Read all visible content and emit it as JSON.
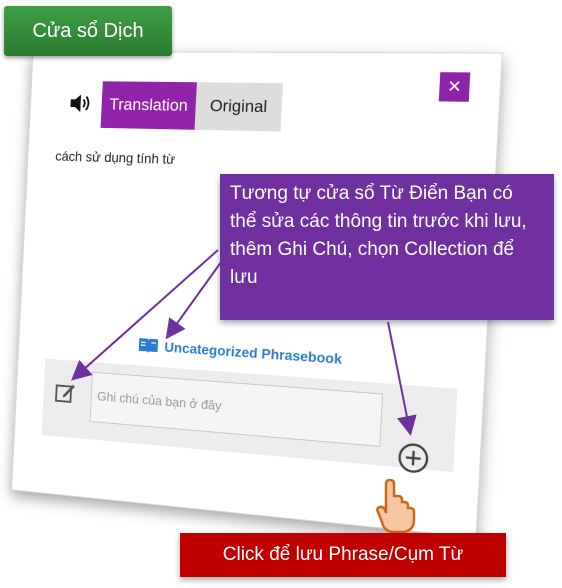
{
  "title_tag": "Cửa sổ Dịch",
  "tabs": {
    "translation": "Translation",
    "original": "Original"
  },
  "close_label": "✕",
  "source_text": "cách sử dụng tính từ",
  "collection_label": "Uncategorized Phrasebook",
  "note_placeholder": "Ghi chú của bạn ở đây",
  "callout_text": "Tương tự cửa sổ Từ Điển Bạn có thể sửa các thông tin trước khi lưu, thêm Ghi Chú, chọn Collection để lưu",
  "click_note": "Click để lưu Phrase/Cụm Từ",
  "colors": {
    "accent": "#8e24aa",
    "callout": "#7030a0",
    "tag": "#3a963e",
    "note": "#c00000",
    "link": "#2a7dd0"
  },
  "icons": [
    "speaker-icon",
    "close-icon",
    "book-icon",
    "edit-icon",
    "add-icon",
    "pointer-hand-icon"
  ]
}
